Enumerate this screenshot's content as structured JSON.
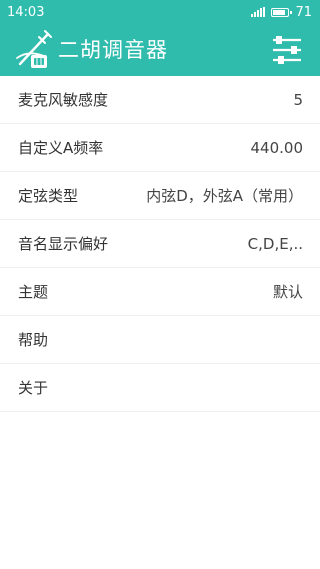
{
  "status_bar": {
    "time": "14:03",
    "battery_level": "71"
  },
  "app_bar": {
    "title": "二胡调音器",
    "logo_icon": "erhu-icon",
    "settings_icon": "sliders-icon",
    "color": "#2fbcad"
  },
  "settings": [
    {
      "label": "麦克风敏感度",
      "value": "5"
    },
    {
      "label": "自定义A频率",
      "value": "440.00"
    },
    {
      "label": "定弦类型",
      "value": "内弦D，外弦A（常用）"
    },
    {
      "label": "音名显示偏好",
      "value": "C,D,E,.."
    },
    {
      "label": "主题",
      "value": "默认"
    },
    {
      "label": "帮助",
      "value": ""
    },
    {
      "label": "关于",
      "value": ""
    }
  ]
}
